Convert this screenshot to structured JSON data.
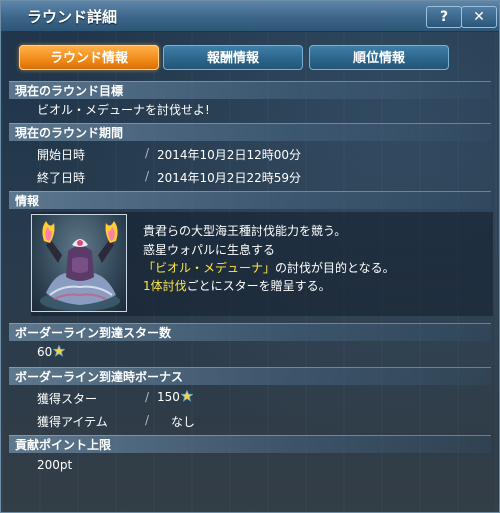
{
  "window": {
    "title": "ラウンド詳細",
    "help_label": "?",
    "close_label": "✕"
  },
  "tabs": [
    {
      "label": "ラウンド情報",
      "active": true
    },
    {
      "label": "報酬情報",
      "active": false
    },
    {
      "label": "順位情報",
      "active": false
    }
  ],
  "goal": {
    "header": "現在のラウンド目標",
    "text": "ビオル・メデューナを討伐せよ!"
  },
  "period": {
    "header": "現在のラウンド期間",
    "start_label": "開始日時",
    "start_value": "2014年10月2日12時00分",
    "end_label": "終了日時",
    "end_value": "2014年10月2日22時59分",
    "separator": "/"
  },
  "info": {
    "header": "情報",
    "line1": "貴君らの大型海王種討伐能力を競う。",
    "line2": "惑星ウォパルに生息する",
    "line3_highlight": "「ビオル・メデューナ」",
    "line3_rest": "の討伐が目的となる。",
    "line4_highlight": "1体討伐",
    "line4_rest": "ごとにスターを贈呈する。",
    "portrait_icon": "bioru-meduna-portrait-icon"
  },
  "border_stars": {
    "header": "ボーダーライン到達スター数",
    "value": "60"
  },
  "border_bonus": {
    "header": "ボーダーライン到達時ボーナス",
    "stars_label": "獲得スター",
    "stars_value": "150",
    "item_label": "獲得アイテム",
    "item_value": "なし",
    "separator": "/"
  },
  "contribution": {
    "header": "貢献ポイント上限",
    "value": "200pt"
  },
  "colors": {
    "accent_orange": "#f08a18",
    "tab_blue": "#2b648a",
    "highlight_yellow": "#ffe640",
    "star_color": "#ffd23a"
  }
}
